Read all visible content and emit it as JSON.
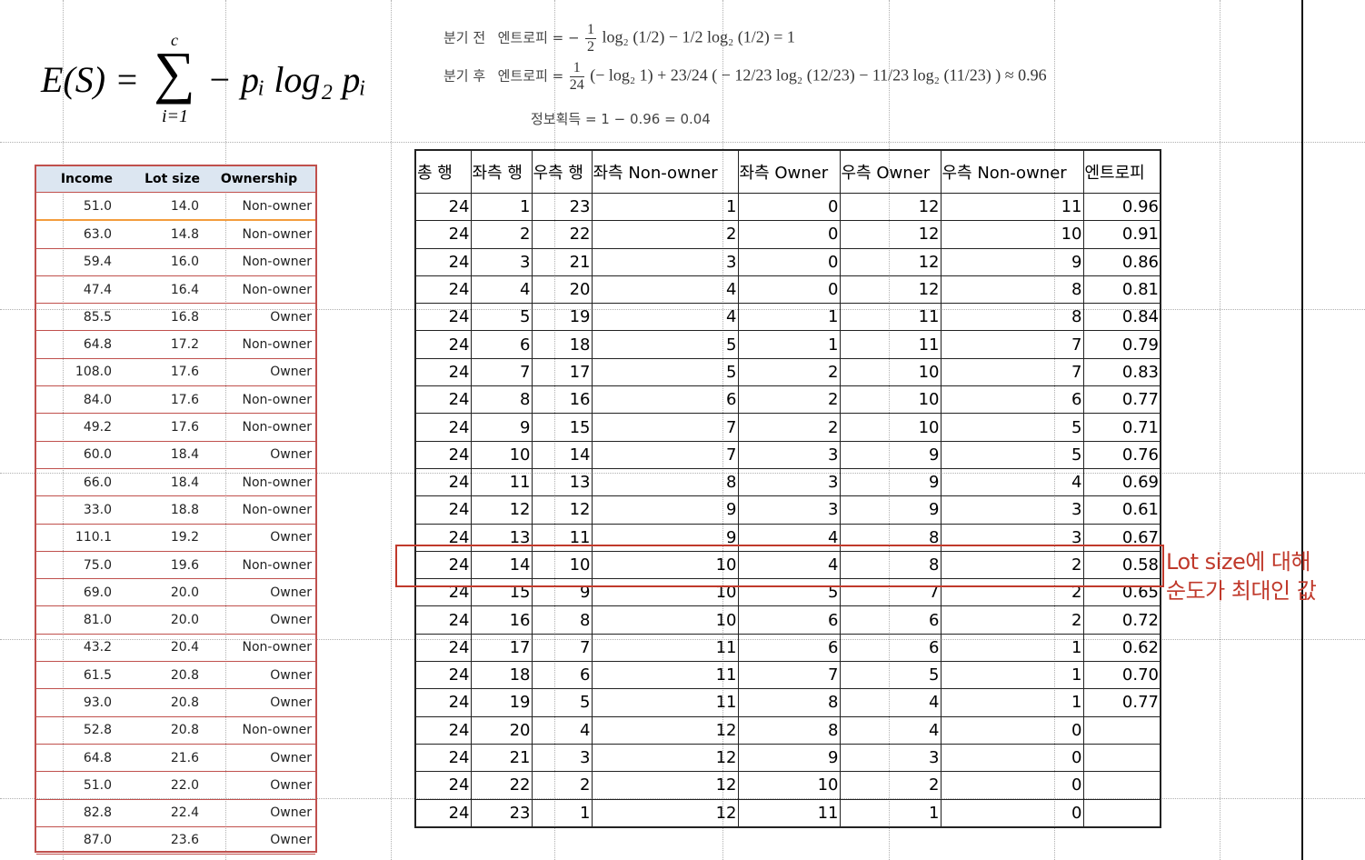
{
  "formula": {
    "lhs": "E(S) =",
    "sum_upper": "c",
    "sum_lower": "i=1",
    "rhs": "− pᵢ log₂ pᵢ"
  },
  "calc": {
    "before_label": "분기   전",
    "before_prefix": "엔트로피 = −",
    "before_text": "log₂ (1/2) − 1/2 log₂ (1/2) = 1",
    "after_label": "분기   후",
    "after_prefix": "엔트로피 =",
    "after_text": "(− log₂ 1) + 23/24 ( − 12/23 log₂ (12/23) − 11/23 log₂ (11/23) ) ≈ 0.96",
    "gain": "정보획득 = 1 − 0.96 = 0.04"
  },
  "left_table": {
    "headers": [
      "Income",
      "Lot size",
      "Ownership"
    ],
    "rows": [
      [
        "51.0",
        "14.0",
        "Non-owner"
      ],
      [
        "63.0",
        "14.8",
        "Non-owner"
      ],
      [
        "59.4",
        "16.0",
        "Non-owner"
      ],
      [
        "47.4",
        "16.4",
        "Non-owner"
      ],
      [
        "85.5",
        "16.8",
        "Owner"
      ],
      [
        "64.8",
        "17.2",
        "Non-owner"
      ],
      [
        "108.0",
        "17.6",
        "Owner"
      ],
      [
        "84.0",
        "17.6",
        "Non-owner"
      ],
      [
        "49.2",
        "17.6",
        "Non-owner"
      ],
      [
        "60.0",
        "18.4",
        "Owner"
      ],
      [
        "66.0",
        "18.4",
        "Non-owner"
      ],
      [
        "33.0",
        "18.8",
        "Non-owner"
      ],
      [
        "110.1",
        "19.2",
        "Owner"
      ],
      [
        "75.0",
        "19.6",
        "Non-owner"
      ],
      [
        "69.0",
        "20.0",
        "Owner"
      ],
      [
        "81.0",
        "20.0",
        "Owner"
      ],
      [
        "43.2",
        "20.4",
        "Non-owner"
      ],
      [
        "61.5",
        "20.8",
        "Owner"
      ],
      [
        "93.0",
        "20.8",
        "Owner"
      ],
      [
        "52.8",
        "20.8",
        "Non-owner"
      ],
      [
        "64.8",
        "21.6",
        "Owner"
      ],
      [
        "51.0",
        "22.0",
        "Owner"
      ],
      [
        "82.8",
        "22.4",
        "Owner"
      ],
      [
        "87.0",
        "23.6",
        "Owner"
      ]
    ]
  },
  "right_table": {
    "headers": [
      "총 행",
      "좌측 행",
      "우측 행",
      "좌측 Non-owner",
      "좌측 Owner",
      "우측 Owner",
      "우측 Non-owner",
      "엔트로피"
    ],
    "rows": [
      [
        "24",
        "1",
        "23",
        "1",
        "0",
        "12",
        "11",
        "0.96"
      ],
      [
        "24",
        "2",
        "22",
        "2",
        "0",
        "12",
        "10",
        "0.91"
      ],
      [
        "24",
        "3",
        "21",
        "3",
        "0",
        "12",
        "9",
        "0.86"
      ],
      [
        "24",
        "4",
        "20",
        "4",
        "0",
        "12",
        "8",
        "0.81"
      ],
      [
        "24",
        "5",
        "19",
        "4",
        "1",
        "11",
        "8",
        "0.84"
      ],
      [
        "24",
        "6",
        "18",
        "5",
        "1",
        "11",
        "7",
        "0.79"
      ],
      [
        "24",
        "7",
        "17",
        "5",
        "2",
        "10",
        "7",
        "0.83"
      ],
      [
        "24",
        "8",
        "16",
        "6",
        "2",
        "10",
        "6",
        "0.77"
      ],
      [
        "24",
        "9",
        "15",
        "7",
        "2",
        "10",
        "5",
        "0.71"
      ],
      [
        "24",
        "10",
        "14",
        "7",
        "3",
        "9",
        "5",
        "0.76"
      ],
      [
        "24",
        "11",
        "13",
        "8",
        "3",
        "9",
        "4",
        "0.69"
      ],
      [
        "24",
        "12",
        "12",
        "9",
        "3",
        "9",
        "3",
        "0.61"
      ],
      [
        "24",
        "13",
        "11",
        "9",
        "4",
        "8",
        "3",
        "0.67"
      ],
      [
        "24",
        "14",
        "10",
        "10",
        "4",
        "8",
        "2",
        "0.58"
      ],
      [
        "24",
        "15",
        "9",
        "10",
        "5",
        "7",
        "2",
        "0.65"
      ],
      [
        "24",
        "16",
        "8",
        "10",
        "6",
        "6",
        "2",
        "0.72"
      ],
      [
        "24",
        "17",
        "7",
        "11",
        "6",
        "6",
        "1",
        "0.62"
      ],
      [
        "24",
        "18",
        "6",
        "11",
        "7",
        "5",
        "1",
        "0.70"
      ],
      [
        "24",
        "19",
        "5",
        "11",
        "8",
        "4",
        "1",
        "0.77"
      ],
      [
        "24",
        "20",
        "4",
        "12",
        "8",
        "4",
        "0",
        ""
      ],
      [
        "24",
        "21",
        "3",
        "12",
        "9",
        "3",
        "0",
        ""
      ],
      [
        "24",
        "22",
        "2",
        "12",
        "10",
        "2",
        "0",
        ""
      ],
      [
        "24",
        "23",
        "1",
        "12",
        "11",
        "1",
        "0",
        ""
      ]
    ]
  },
  "annotation": {
    "line1": "Lot size에 대해",
    "line2": "순도가 최대인 값"
  },
  "colors": {
    "highlight": "#c0392b",
    "table_border": "#c0504d",
    "header_bg": "#dce6f1",
    "first_row_line": "#f39c3d"
  }
}
